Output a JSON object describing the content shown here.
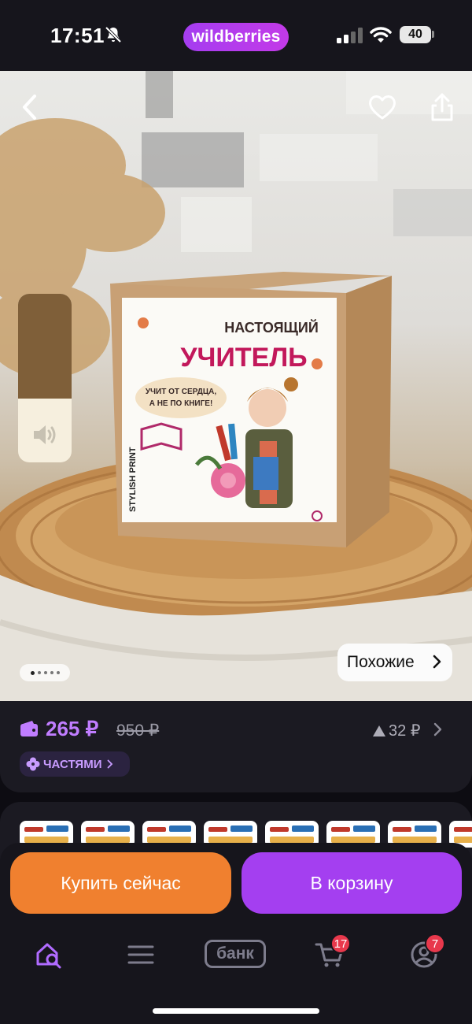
{
  "status_bar": {
    "time": "17:51",
    "brand": "wildberries",
    "battery": "40"
  },
  "product": {
    "box_text": {
      "line1": "НАСТОЯЩИЙ",
      "line2": "УЧИТЕЛЬ",
      "bubble_line1": "УЧИТ ОТ СЕРДЦА,",
      "bubble_line2": "А НЕ ПО КНИГЕ!",
      "brand_side": "STYLISH PRINT"
    },
    "volume_level": 0.62,
    "gallery_dots": 5,
    "active_dot": 0,
    "similar_label": "Похожие"
  },
  "price": {
    "current": "265 ₽",
    "old": "950 ₽",
    "diff": "32 ₽",
    "parts_label": "ЧАСТЯМИ"
  },
  "thumbnails_count": 8,
  "actions": {
    "buy_now": "Купить сейчас",
    "add_to_cart": "В корзину"
  },
  "nav": {
    "bank_label": "банк",
    "cart_badge": "17",
    "profile_badge": "7"
  },
  "colors": {
    "brand_purple": "#a43ff0",
    "buy_orange": "#f0802f",
    "price_purple": "#c07dff",
    "badge_red": "#e8384c"
  }
}
